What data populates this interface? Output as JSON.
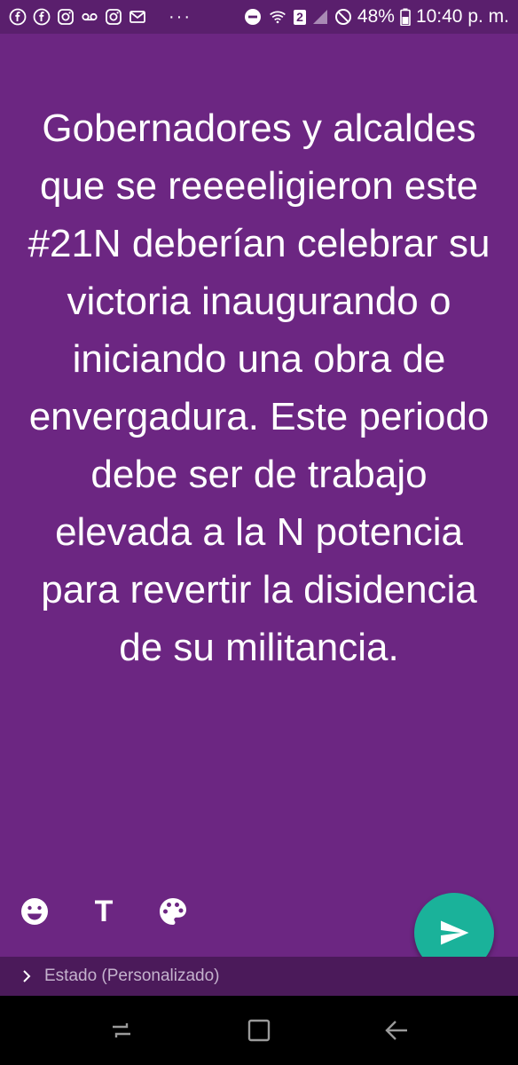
{
  "status_bar": {
    "battery": "48%",
    "time": "10:40 p. m.",
    "sim_badge": "2",
    "overflow": "···",
    "left_icons": [
      "facebook-icon",
      "facebook-icon",
      "instagram-icon",
      "voicemail-icon",
      "instagram-icon",
      "gmail-icon"
    ]
  },
  "status_text": "Gobernadores y alcaldes que se reeeeligieron este #21N deberían celebrar su victoria inaugurando o iniciando una obra de envergadura. Este periodo debe ser de trabajo elevada a la N potencia para revertir la disidencia de su militancia.",
  "toolbar": {
    "text_tool_label": "T"
  },
  "caption": {
    "placeholder": "Estado (Personalizado)"
  },
  "colors": {
    "background": "#6c2682",
    "send_button": "#1ab29a",
    "caption_bar": "#4b1a5a"
  }
}
